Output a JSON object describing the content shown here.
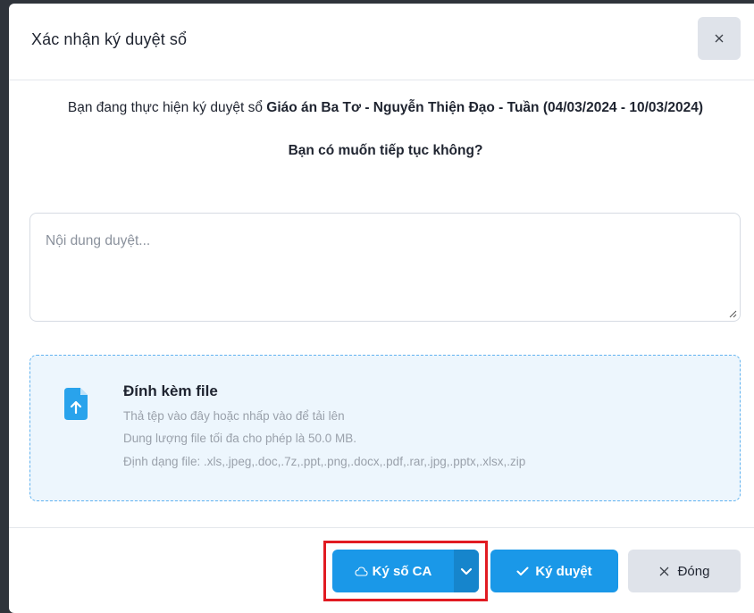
{
  "modal": {
    "title": "Xác nhận ký duyệt sổ",
    "close_icon": "close-icon"
  },
  "body": {
    "confirm_prefix": "Bạn đang thực hiện ký duyệt sổ ",
    "book_name": "Giáo án Ba Tơ - Nguyễn Thiện Đạo - Tuần (04/03/2024 - 10/03/2024)",
    "question": "Bạn có muốn tiếp tục không?",
    "content_placeholder": "Nội dung duyệt...",
    "content_value": ""
  },
  "attachment": {
    "title": "Đính kèm file",
    "hint": "Thả tệp vào đây hoặc nhấp vào để tải lên",
    "size_limit": "Dung lượng file tối đa cho phép là 50.0 MB.",
    "formats": "Định dạng file: .xls,.jpeg,.doc,.7z,.ppt,.png,.docx,.pdf,.rar,.jpg,.pptx,.xlsx,.zip",
    "icon": "file-upload-icon"
  },
  "footer": {
    "sign_ca_label": "Ký số CA",
    "sign_ca_icon": "cloud-icon",
    "dropdown_icon": "chevron-down-icon",
    "approve_label": "Ký duyệt",
    "approve_icon": "check-icon",
    "close_label": "Đóng",
    "close_icon": "close-icon"
  },
  "colors": {
    "primary": "#1a98e8",
    "highlight": "#e11b22",
    "dropzone_border": "#62b3f0",
    "dropzone_bg": "#edf6fd"
  }
}
